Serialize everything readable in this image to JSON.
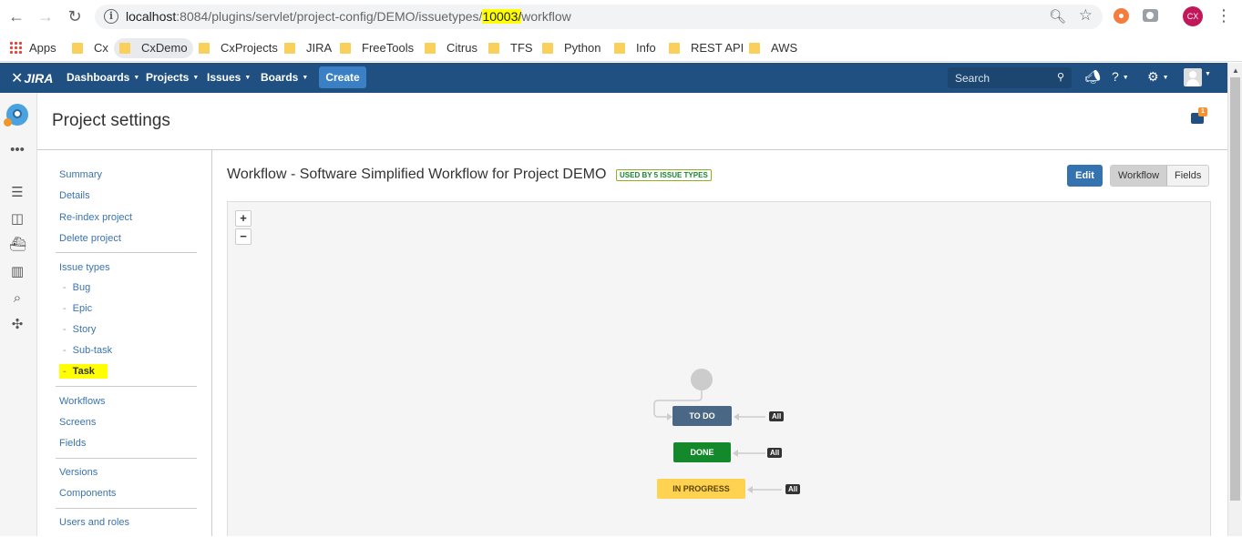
{
  "browser": {
    "url_host": "localhost",
    "url_port_path_before": ":8084/plugins/servlet/project-config/DEMO/issuetypes/",
    "url_highlight": "10003/",
    "url_after": "workflow",
    "profile_initials": "CX"
  },
  "bookmarks": {
    "apps": "Apps",
    "items": [
      "Cx",
      "CxDemo",
      "CxProjects",
      "JIRA",
      "FreeTools",
      "Citrus",
      "TFS",
      "Python",
      "Info",
      "REST API",
      "AWS"
    ]
  },
  "jira_header": {
    "logo": "JIRA",
    "nav": [
      "Dashboards",
      "Projects",
      "Issues",
      "Boards"
    ],
    "create": "Create",
    "search_placeholder": "Search"
  },
  "page": {
    "title": "Project settings",
    "feedback_count": "1"
  },
  "sidebar": {
    "group1": [
      "Summary",
      "Details",
      "Re-index project",
      "Delete project"
    ],
    "issue_types_label": "Issue types",
    "issue_types": [
      "Bug",
      "Epic",
      "Story",
      "Sub-task",
      "Task"
    ],
    "group3": [
      "Workflows",
      "Screens",
      "Fields"
    ],
    "group4": [
      "Versions",
      "Components"
    ],
    "group5": [
      "Users and roles"
    ]
  },
  "workflow": {
    "title": "Workflow - Software Simplified Workflow for Project DEMO",
    "badge": "USED BY 5 ISSUE TYPES",
    "edit": "Edit",
    "view_workflow": "Workflow",
    "view_fields": "Fields",
    "zoom_in": "+",
    "zoom_out": "−",
    "statuses": [
      "TO DO",
      "DONE",
      "IN PROGRESS"
    ],
    "transition_label": "All",
    "colors": {
      "todo": "#4a6785",
      "done": "#14892c",
      "in_progress": "#ffd351"
    }
  }
}
